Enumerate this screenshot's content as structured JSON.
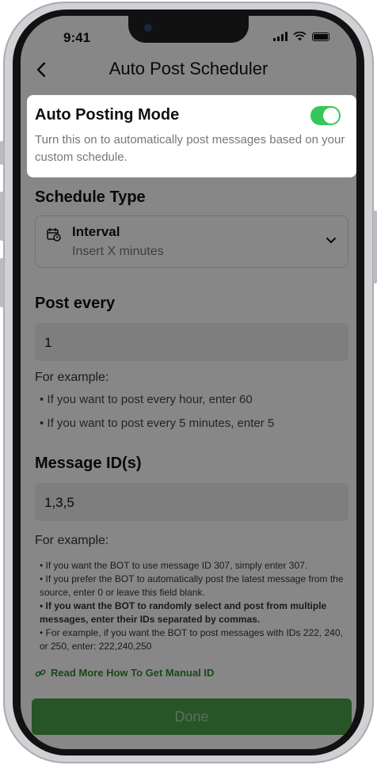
{
  "status_bar": {
    "time": "9:41"
  },
  "header": {
    "title": "Auto Post Scheduler"
  },
  "auto_posting": {
    "title": "Auto Posting Mode",
    "description": "Turn this on to automatically post messages based on your custom schedule.",
    "enabled": true
  },
  "schedule_type": {
    "title": "Schedule Type",
    "selected": "Interval",
    "hint": "Insert X minutes"
  },
  "post_every": {
    "title": "Post every",
    "value": "1",
    "example_title": "For example:",
    "examples": [
      "• If you want to post every hour, enter 60",
      "• If you want to post every 5 minutes, enter 5"
    ]
  },
  "message_ids": {
    "title": "Message ID(s)",
    "value": "1,3,5",
    "example_title": "For example:",
    "notes": [
      "• If you want the BOT to use message ID 307, simply enter 307.",
      "• If you prefer the BOT to automatically post the latest message from the source, enter 0 or leave this field blank.",
      "• If you want the BOT to randomly select and post from multiple messages, enter their IDs separated by commas.",
      "• For example, if you want the BOT to post messages with IDs 222, 240, or 250, enter: 222,240,250"
    ],
    "link": "Read More How To Get Manual ID"
  },
  "done_button": {
    "label": "Done"
  },
  "colors": {
    "toggle_on": "#35c759",
    "accent_green": "#2e8b2e",
    "done_bg": "#4ca04a"
  }
}
